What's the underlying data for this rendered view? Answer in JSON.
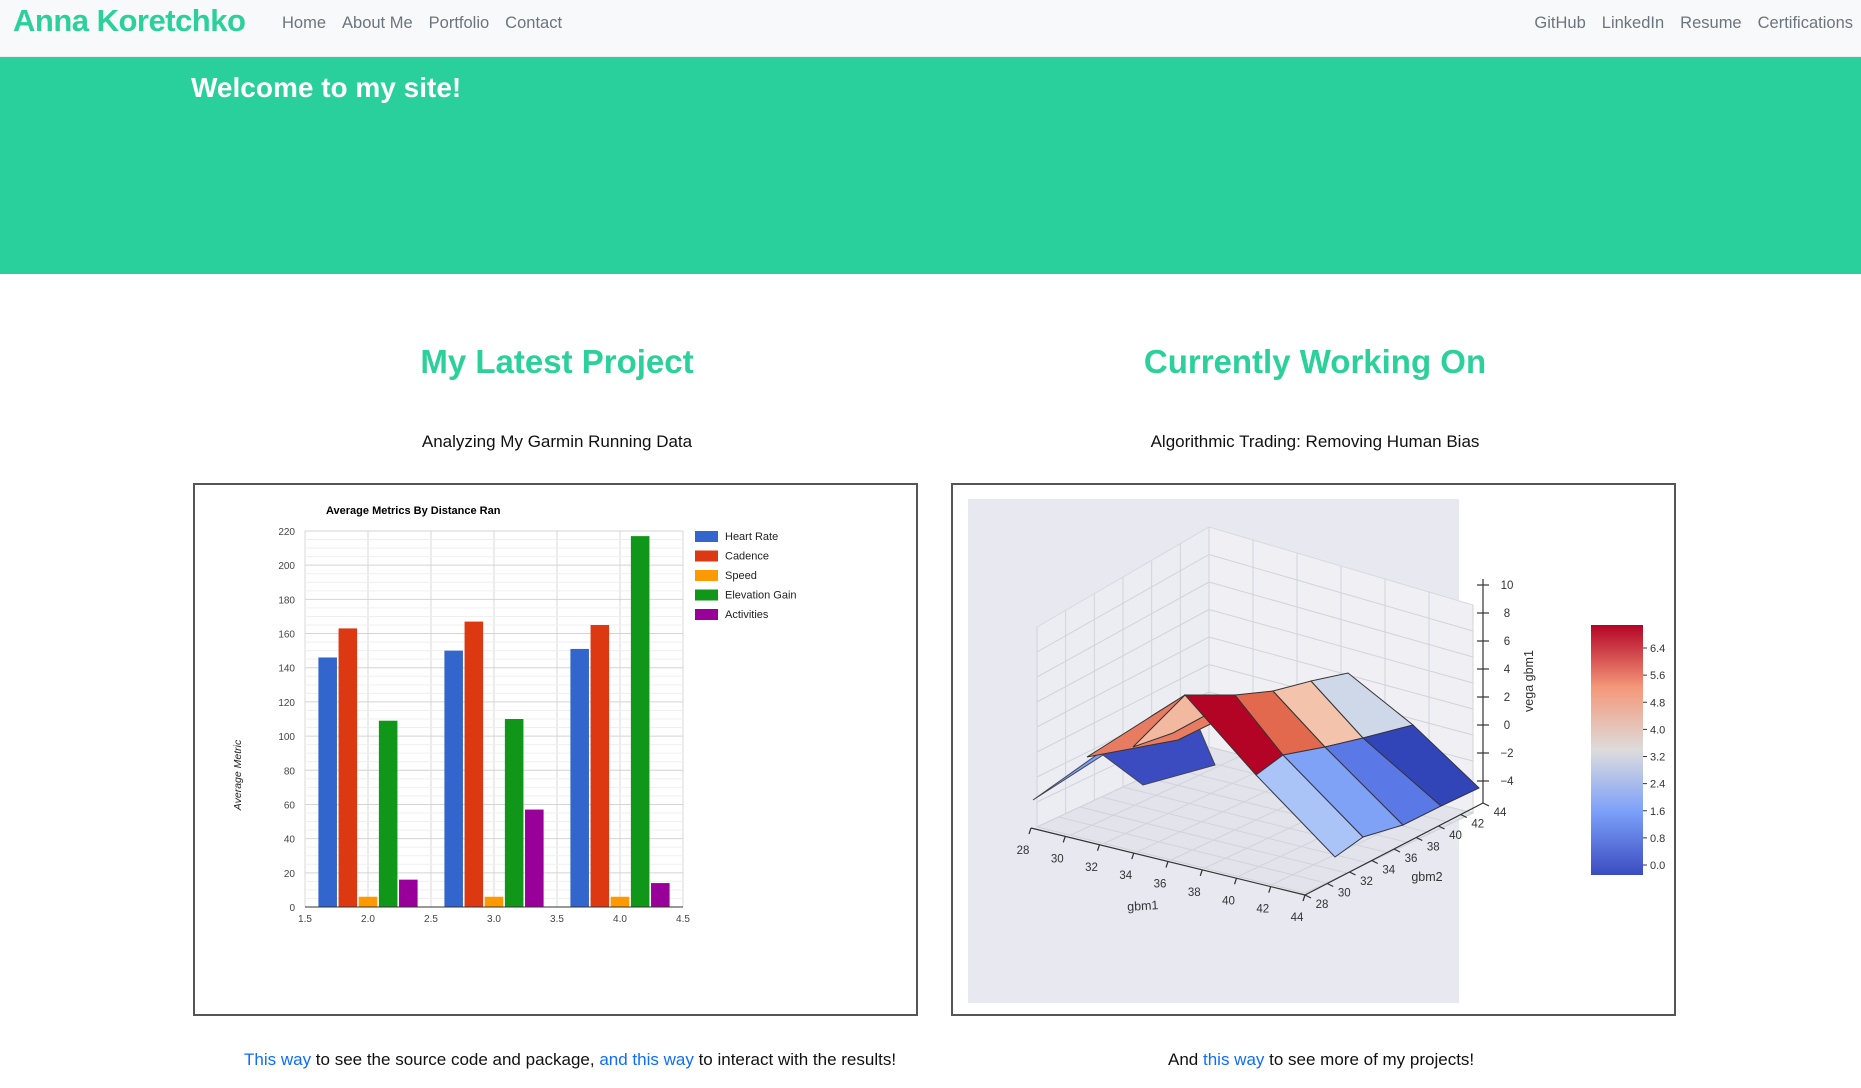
{
  "navbar": {
    "brand": "Anna Koretchko",
    "left_links": [
      "Home",
      "About Me",
      "Portfolio",
      "Contact"
    ],
    "right_links": [
      "GitHub",
      "LinkedIn",
      "Resume",
      "Certifications"
    ]
  },
  "hero": {
    "title": "Welcome to my site!"
  },
  "latest_project": {
    "heading": "My Latest Project",
    "subtitle": "Analyzing My Garmin Running Data"
  },
  "current_work": {
    "heading": "Currently Working On",
    "subtitle": "Algorithmic Trading: Removing Human Bias"
  },
  "footer_left": {
    "link1": "This way",
    "text1": " to see the source code and package, ",
    "link2": "and this way",
    "text2": " to interact with the results!"
  },
  "footer_right": {
    "text1": "And ",
    "link1": "this way",
    "text2": " to see more of my projects!"
  },
  "colors": {
    "accent": "#2bd09a",
    "hero_bg": "#2ad09b",
    "link": "#0d6efd"
  },
  "chart_data": [
    {
      "type": "bar",
      "title": "Average Metrics By Distance Ran",
      "xlabel": "",
      "ylabel": "Average Metric",
      "xlim": [
        1.5,
        4.5
      ],
      "ylim": [
        0,
        220
      ],
      "x_ticks": [
        "1.5",
        "2.0",
        "2.5",
        "3.0",
        "3.5",
        "4.0",
        "4.5"
      ],
      "y_ticks": [
        "0",
        "20",
        "40",
        "60",
        "80",
        "100",
        "120",
        "140",
        "160",
        "180",
        "200",
        "220"
      ],
      "x": [
        2,
        3,
        4
      ],
      "grid": true,
      "legend": "top-right",
      "series": [
        {
          "name": "Heart Rate",
          "color": "#3366cc",
          "values": [
            146,
            150,
            151
          ]
        },
        {
          "name": "Cadence",
          "color": "#dc3912",
          "values": [
            163,
            167,
            165
          ]
        },
        {
          "name": "Speed",
          "color": "#ff9900",
          "values": [
            6,
            6,
            6
          ]
        },
        {
          "name": "Elevation Gain",
          "color": "#109618",
          "values": [
            109,
            110,
            217
          ]
        },
        {
          "name": "Activities",
          "color": "#990099",
          "values": [
            16,
            57,
            14
          ]
        }
      ]
    },
    {
      "type": "other",
      "xlabel": "gbm1",
      "ylabel": "gbm2",
      "zlabel": "vega gbm1",
      "x_ticks": [
        "28",
        "30",
        "32",
        "34",
        "36",
        "38",
        "40",
        "42",
        "44"
      ],
      "y_ticks": [
        "28",
        "30",
        "32",
        "34",
        "36",
        "38",
        "40",
        "42",
        "44"
      ],
      "z_ticks": [
        "10",
        "8",
        "6",
        "4",
        "2",
        "0",
        "−2",
        "−4"
      ],
      "colorbar_ticks": [
        "6.4",
        "5.6",
        "4.8",
        "4.0",
        "3.2",
        "2.4",
        "1.6",
        "0.8",
        "0.0"
      ],
      "colormap": "coolwarm"
    }
  ]
}
